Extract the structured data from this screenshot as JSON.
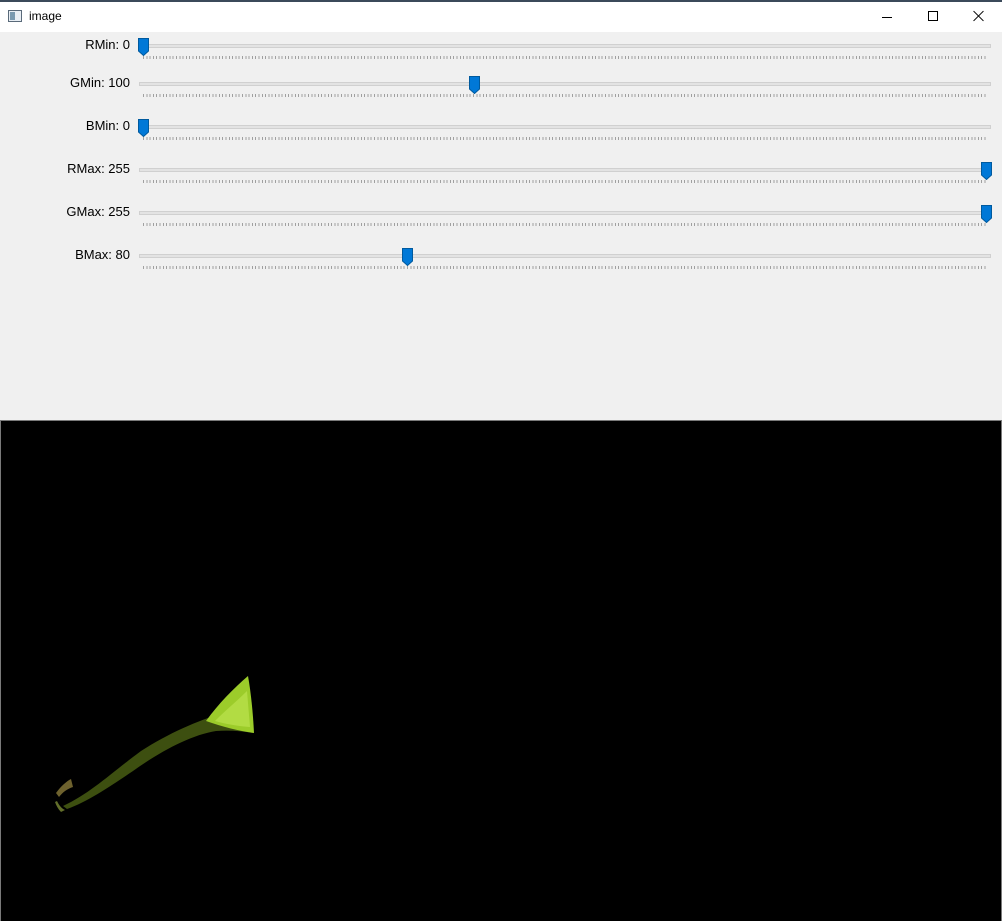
{
  "window": {
    "title": "image"
  },
  "sliders": [
    {
      "id": "rmin",
      "label": "RMin: 0",
      "value": 0,
      "max": 255
    },
    {
      "id": "gmin",
      "label": "GMin: 100",
      "value": 100,
      "max": 255
    },
    {
      "id": "bmin",
      "label": "BMin: 0",
      "value": 0,
      "max": 255
    },
    {
      "id": "rmax",
      "label": "RMax: 255",
      "value": 255,
      "max": 255
    },
    {
      "id": "gmax",
      "label": "GMax: 255",
      "value": 255,
      "max": 255
    },
    {
      "id": "bmax",
      "label": "BMax: 80",
      "value": 80,
      "max": 255
    }
  ],
  "colors": {
    "thumb": "#0078d7",
    "background": "#f0f0f0",
    "canvas": "#000000",
    "leaf": "#9ccc2a"
  },
  "icons": {
    "app": "window-icon",
    "minimize": "minimize-icon",
    "maximize": "maximize-icon",
    "close": "close-icon"
  }
}
